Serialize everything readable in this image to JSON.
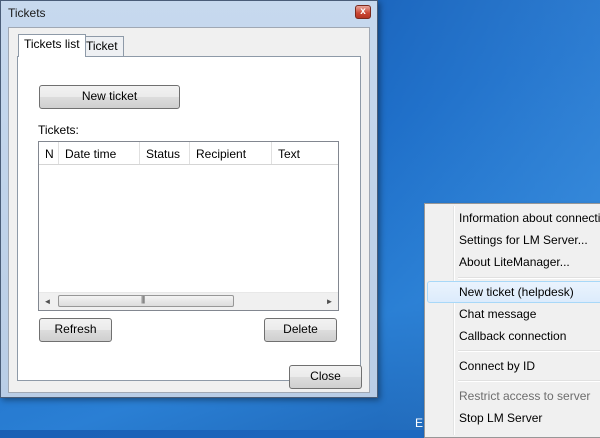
{
  "window": {
    "title": "Tickets",
    "close_glyph": "x"
  },
  "tabs": [
    {
      "label": "Tickets list",
      "active": true
    },
    {
      "label": "Ticket",
      "active": false
    }
  ],
  "tickets_list": {
    "new_ticket_button": "New ticket",
    "tickets_label": "Tickets:",
    "columns": [
      "N",
      "Date time",
      "Status",
      "Recipient",
      "Text"
    ],
    "rows": [],
    "scroll_left": "◄",
    "scroll_right": "►",
    "scroll_grip": "|||",
    "refresh_button": "Refresh",
    "delete_button": "Delete"
  },
  "close_button": "Close",
  "context_menu": {
    "items": [
      {
        "label": "Information about connections",
        "state": "normal"
      },
      {
        "label": "Settings for LM Server...",
        "state": "normal"
      },
      {
        "label": "About LiteManager...",
        "state": "normal"
      },
      {
        "label": "New ticket (helpdesk)",
        "state": "highlighted"
      },
      {
        "label": "Chat message",
        "state": "normal"
      },
      {
        "label": "Callback connection",
        "state": "normal"
      },
      {
        "label": "Connect by ID",
        "state": "normal"
      },
      {
        "label": "Restrict access to server",
        "state": "disabled"
      },
      {
        "label": "Stop LM Server",
        "state": "normal"
      }
    ]
  },
  "taskbar": {
    "partial_text": "E"
  },
  "colors": {
    "desktop": "#1e6ec8",
    "window_frame": "#c7d9ee",
    "close_red": "#c94532",
    "menu_highlight": "#dcebfc"
  }
}
